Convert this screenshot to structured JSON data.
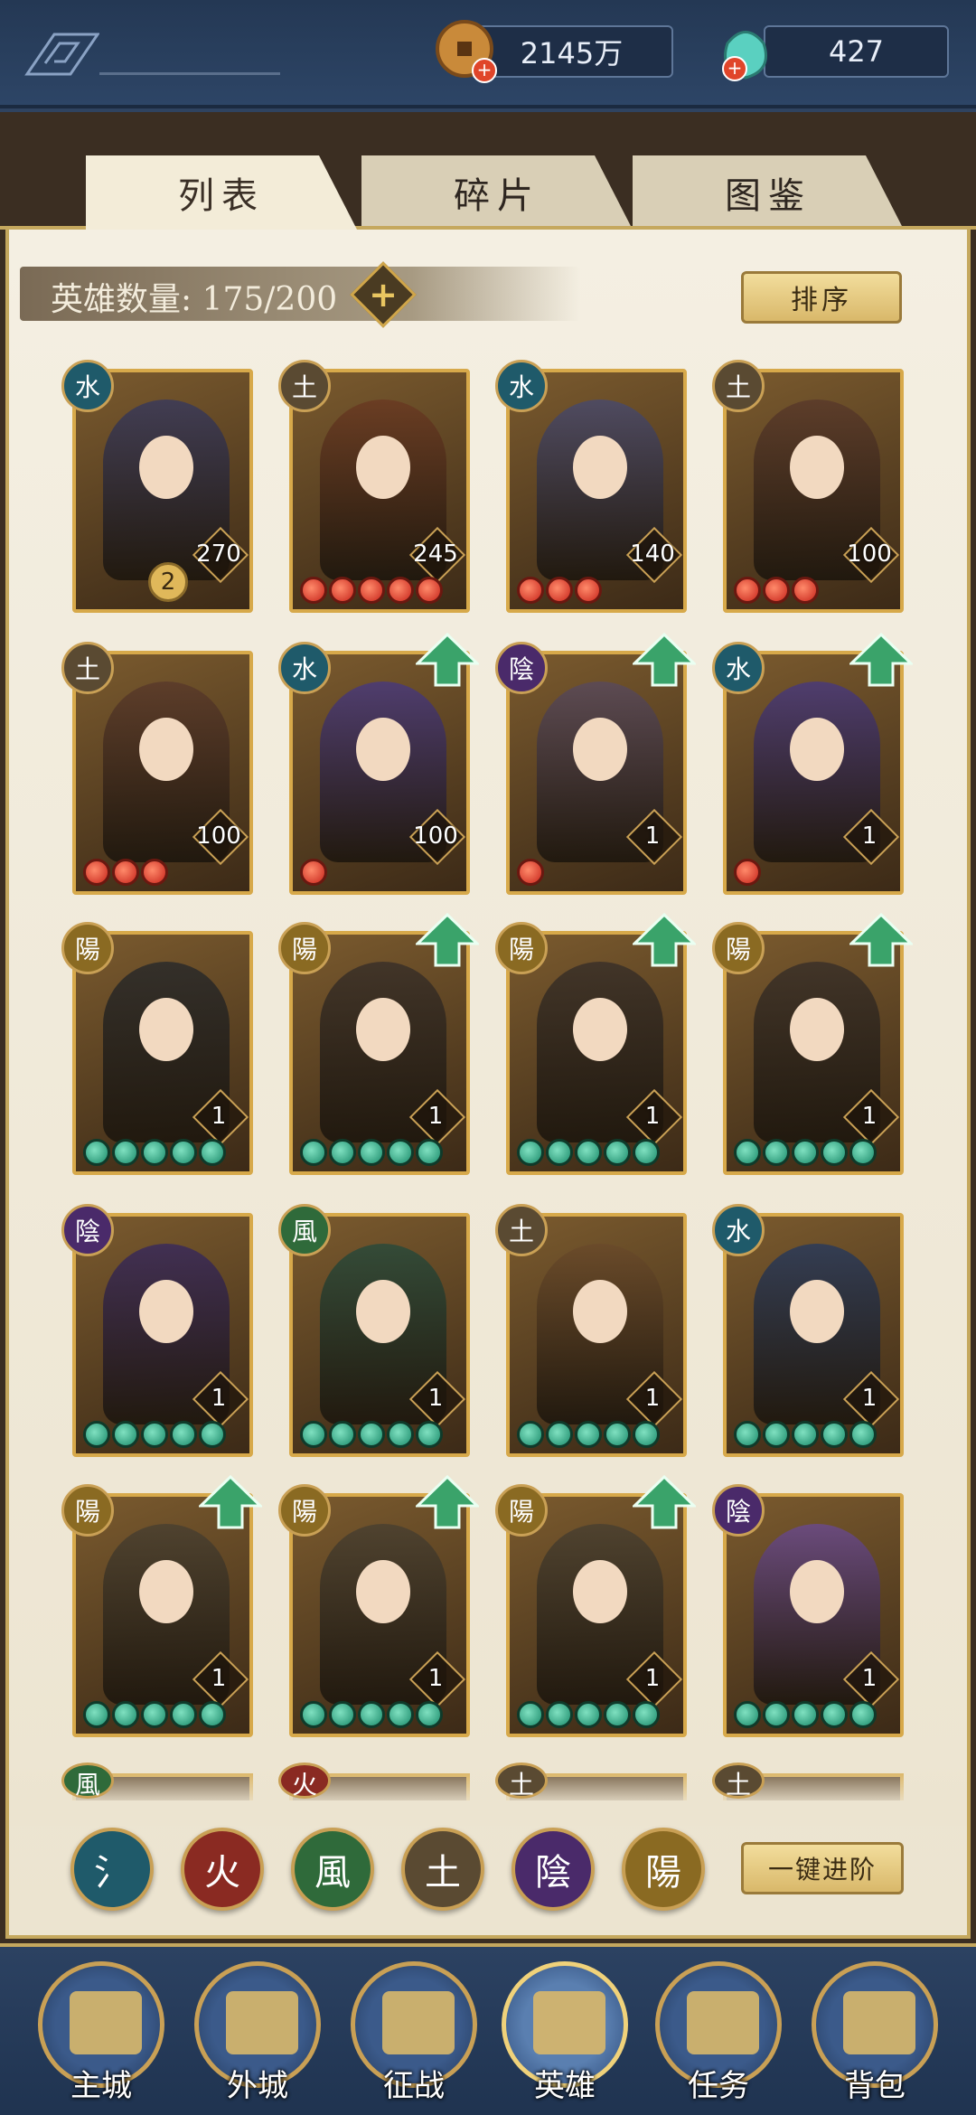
{
  "resources": {
    "coins": "2145万",
    "gems": "427"
  },
  "tabs": [
    {
      "label": "列表",
      "active": true
    },
    {
      "label": "碎片",
      "active": false
    },
    {
      "label": "图鉴",
      "active": false
    }
  ],
  "hero_count": {
    "label": "英雄数量: 175/200",
    "add": "+"
  },
  "sort_button": "排序",
  "advance_button": "一键进阶",
  "elements": {
    "water": "氵",
    "fire": "火",
    "wind": "風",
    "earth": "土",
    "yin": "陰",
    "yang": "陽"
  },
  "heroes": [
    {
      "element": "水",
      "elem_key": "water",
      "level": "270",
      "stars": 0,
      "star_type": "none",
      "badge": "2",
      "upgrade": false,
      "tint": "#3a3a5a"
    },
    {
      "element": "土",
      "elem_key": "earth",
      "level": "245",
      "stars": 5,
      "star_type": "red",
      "upgrade": false,
      "tint": "#6a3a22"
    },
    {
      "element": "水",
      "elem_key": "water",
      "level": "140",
      "stars": 3,
      "star_type": "red",
      "upgrade": false,
      "tint": "#4a4a6a"
    },
    {
      "element": "土",
      "elem_key": "earth",
      "level": "100",
      "stars": 3,
      "star_type": "red",
      "upgrade": false,
      "tint": "#5a3a2a"
    },
    {
      "element": "土",
      "elem_key": "earth",
      "level": "100",
      "stars": 3,
      "star_type": "red",
      "upgrade": false,
      "tint": "#5a3a2a"
    },
    {
      "element": "水",
      "elem_key": "water",
      "level": "100",
      "stars": 1,
      "star_type": "red",
      "upgrade": true,
      "tint": "#4a3a7a"
    },
    {
      "element": "陰",
      "elem_key": "yin",
      "level": "1",
      "stars": 1,
      "star_type": "red",
      "upgrade": true,
      "tint": "#5a4a5a"
    },
    {
      "element": "水",
      "elem_key": "water",
      "level": "1",
      "stars": 1,
      "star_type": "red",
      "upgrade": true,
      "tint": "#4a3a7a"
    },
    {
      "element": "陽",
      "elem_key": "yang",
      "level": "1",
      "stars": 5,
      "star_type": "green",
      "upgrade": false,
      "tint": "#2a2a2a"
    },
    {
      "element": "陽",
      "elem_key": "yang",
      "level": "1",
      "stars": 5,
      "star_type": "green",
      "upgrade": true,
      "tint": "#3a3028"
    },
    {
      "element": "陽",
      "elem_key": "yang",
      "level": "1",
      "stars": 5,
      "star_type": "green",
      "upgrade": true,
      "tint": "#3a3028"
    },
    {
      "element": "陽",
      "elem_key": "yang",
      "level": "1",
      "stars": 5,
      "star_type": "green",
      "upgrade": true,
      "tint": "#3a3028"
    },
    {
      "element": "陰",
      "elem_key": "yin",
      "level": "1",
      "stars": 5,
      "star_type": "green",
      "upgrade": false,
      "tint": "#3a2a5a"
    },
    {
      "element": "風",
      "elem_key": "wind",
      "level": "1",
      "stars": 5,
      "star_type": "green",
      "upgrade": false,
      "tint": "#2a4a3a"
    },
    {
      "element": "土",
      "elem_key": "earth",
      "level": "1",
      "stars": 5,
      "star_type": "green",
      "upgrade": false,
      "tint": "#6a4a2a"
    },
    {
      "element": "水",
      "elem_key": "water",
      "level": "1",
      "stars": 5,
      "star_type": "green",
      "upgrade": false,
      "tint": "#2a3a5a"
    },
    {
      "element": "陽",
      "elem_key": "yang",
      "level": "1",
      "stars": 5,
      "star_type": "green",
      "upgrade": true,
      "tint": "#4a4030"
    },
    {
      "element": "陽",
      "elem_key": "yang",
      "level": "1",
      "stars": 5,
      "star_type": "green",
      "upgrade": true,
      "tint": "#4a4030"
    },
    {
      "element": "陽",
      "elem_key": "yang",
      "level": "1",
      "stars": 5,
      "star_type": "green",
      "upgrade": true,
      "tint": "#4a4030"
    },
    {
      "element": "陰",
      "elem_key": "yin",
      "level": "1",
      "stars": 5,
      "star_type": "green",
      "upgrade": false,
      "tint": "#6a4a8a"
    }
  ],
  "partial_row_elements": [
    "風",
    "火",
    "土",
    "土"
  ],
  "filters": [
    {
      "key": "water",
      "glyph": "氵"
    },
    {
      "key": "fire",
      "glyph": "火"
    },
    {
      "key": "wind",
      "glyph": "風"
    },
    {
      "key": "earth",
      "glyph": "土"
    },
    {
      "key": "yin",
      "glyph": "陰"
    },
    {
      "key": "yang",
      "glyph": "陽"
    }
  ],
  "nav": [
    {
      "label": "主城",
      "active": false
    },
    {
      "label": "外城",
      "active": false
    },
    {
      "label": "征战",
      "active": false
    },
    {
      "label": "英雄",
      "active": true
    },
    {
      "label": "任务",
      "active": false
    },
    {
      "label": "背包",
      "active": false
    }
  ],
  "colors": {
    "panel_bg": "#f4efe2",
    "gold_border": "#c5a85e",
    "nav_bg": "#2c4262",
    "upgrade_arrow": "#3aa36a"
  }
}
